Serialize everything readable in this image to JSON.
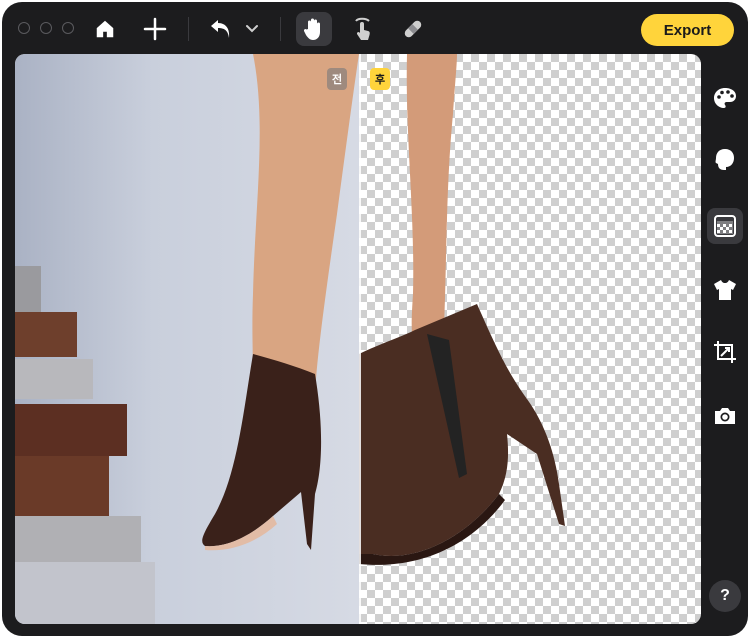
{
  "toolbar": {
    "export_label": "Export",
    "icons": [
      "home-icon",
      "plus-icon",
      "undo-icon",
      "chevron-down-icon",
      "hand-icon",
      "touch-icon",
      "bandage-icon"
    ]
  },
  "canvas": {
    "before_label": "전",
    "after_label": "후"
  },
  "sidebar": {
    "items": [
      "palette-icon",
      "head-icon",
      "transparent-bg-icon",
      "shirt-icon",
      "crop-resize-icon",
      "camera-icon"
    ],
    "active": "transparent-bg-icon"
  },
  "help_label": "?",
  "colors": {
    "accent": "#ffd43b",
    "window_bg": "#1c1c1e",
    "active_bg": "#3a3a3e"
  }
}
